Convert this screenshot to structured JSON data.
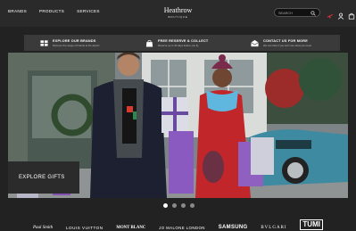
{
  "header": {
    "nav": [
      "BRANDS",
      "PRODUCTS",
      "SERVICES"
    ],
    "logo": {
      "name": "Heathrow",
      "sub": "BOUTIQUE"
    },
    "search": {
      "placeholder": "SEARCH"
    },
    "icons": [
      "plane-icon",
      "user-icon",
      "bag-icon"
    ]
  },
  "info_banner": [
    {
      "icon": "grid-icon",
      "title": "EXPLORE OUR BRANDS",
      "subtitle": "Discover the range of brands at the airport"
    },
    {
      "icon": "bag-icon",
      "title": "FREE RESERVE & COLLECT",
      "subtitle": "Reserve up to 30 days before you fly"
    },
    {
      "icon": "envelope-icon",
      "title": "CONTACT US FOR MORE",
      "subtitle": "We can help if you can't see what you need"
    }
  ],
  "hero": {
    "cta_label": "EXPLORE GIFTS",
    "slides": 4,
    "active_slide": 1
  },
  "brands": [
    "Paul Smith",
    "LOUIS VUITTON",
    "MONT BLANC",
    "JO MALONE LONDON",
    "SAMSUNG",
    "BVLGARI",
    "TUMI"
  ]
}
